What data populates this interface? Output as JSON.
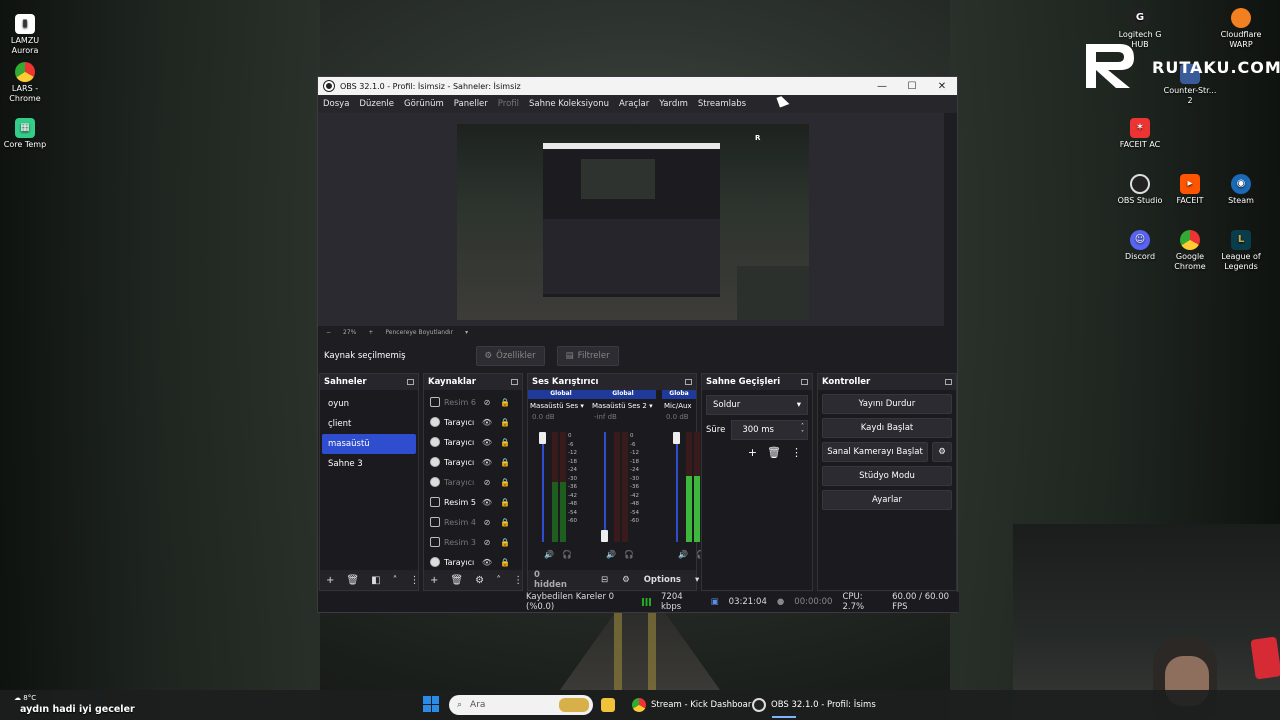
{
  "desktop": {
    "left_icons": [
      {
        "label": "LAMZU\nAurora"
      },
      {
        "label": "LARS -\nChrome"
      },
      {
        "label": "Core Temp"
      }
    ],
    "right_icons": [
      {
        "label": "Logitech G\nHUB"
      },
      {
        "label": "Cloudflare\nWARP"
      },
      {
        "label": "Counter-Str...\n2"
      },
      {
        "label": "FACEIT AC"
      },
      {
        "label": "OBS Studio"
      },
      {
        "label": "FACEIT"
      },
      {
        "label": "Steam"
      },
      {
        "label": "Discord"
      },
      {
        "label": "Google\nChrome"
      },
      {
        "label": "League of\nLegends"
      }
    ],
    "brand_text": "RUTAKU.COM"
  },
  "obs": {
    "title": "OBS 32.1.0 - Profil: İsimsiz - Sahneler: İsimsiz",
    "menu": [
      "Dosya",
      "Düzenle",
      "Görünüm",
      "Paneller",
      "Profil",
      "Sahne Koleksiyonu",
      "Araçlar",
      "Yardım",
      "Streamlabs"
    ],
    "zoom": {
      "value": "27%",
      "fit": "Pencereye Boyutlandır"
    },
    "source_bar": {
      "none_selected": "Kaynak seçilmemiş",
      "properties": "Özellikler",
      "filters": "Filtreler"
    },
    "scenes": {
      "title": "Sahneler",
      "items": [
        "oyun",
        "çlient",
        "masaüstü",
        "Sahne 3"
      ],
      "selected_index": 2
    },
    "sources": {
      "title": "Kaynaklar",
      "items": [
        {
          "name": "Resim 6",
          "type": "image",
          "visible": false
        },
        {
          "name": "Tarayıcı",
          "type": "browser",
          "visible": true
        },
        {
          "name": "Tarayıcı",
          "type": "browser",
          "visible": true
        },
        {
          "name": "Tarayıcı",
          "type": "browser",
          "visible": true
        },
        {
          "name": "Tarayıcı",
          "type": "browser",
          "visible": false
        },
        {
          "name": "Resim 5",
          "type": "image",
          "visible": true
        },
        {
          "name": "Resim 4",
          "type": "image",
          "visible": false
        },
        {
          "name": "Resim 3",
          "type": "image",
          "visible": false
        },
        {
          "name": "Tarayıcı",
          "type": "browser",
          "visible": true
        }
      ]
    },
    "mixer": {
      "title": "Ses Karıştırıcı",
      "channels": [
        {
          "tag": "Global",
          "name": "Masaüstü Ses",
          "level": "0.0 dB",
          "fill": 0.55
        },
        {
          "tag": "Global",
          "name": "Masaüstü Ses 2",
          "level": "-inf dB",
          "fill": 0.0
        },
        {
          "tag": "Globa",
          "name": "Mic/Aux",
          "level": "0.0 dB",
          "fill": 0.6
        }
      ],
      "scale": [
        "0",
        "-6",
        "-12",
        "-18",
        "-24",
        "-30",
        "-36",
        "-42",
        "-48",
        "-54",
        "-60"
      ],
      "footer_hidden": "0 hidden",
      "footer_options": "Options"
    },
    "transitions": {
      "title": "Sahne Geçişleri",
      "type": "Soldur",
      "duration_label": "Süre",
      "duration_value": "300 ms"
    },
    "controls": {
      "title": "Kontroller",
      "buttons": [
        "Yayını Durdur",
        "Kaydı Başlat",
        "Sanal Kamerayı Başlat",
        "Stüdyo Modu",
        "Ayarlar"
      ]
    },
    "status": {
      "dropped": "Kaybedilen Kareler 0 (%0.0)",
      "bitrate": "7204 kbps",
      "stream_time": "03:21:04",
      "rec_time": "00:00:00",
      "cpu": "CPU: 2.7%",
      "fps": "60.00 / 60.00 FPS"
    }
  },
  "taskbar": {
    "weather": "8°C",
    "status_text": "aydın hadi iyi geceler",
    "search_placeholder": "Ara",
    "apps": [
      {
        "label": "Stream - Kick Dashboar"
      },
      {
        "label": "OBS 32.1.0 - Profil: İsims"
      }
    ]
  },
  "colors": {
    "accent": "#2f4ecf",
    "obs_bg": "#1e1e22",
    "mixer_tag": "#1f3a9a"
  }
}
